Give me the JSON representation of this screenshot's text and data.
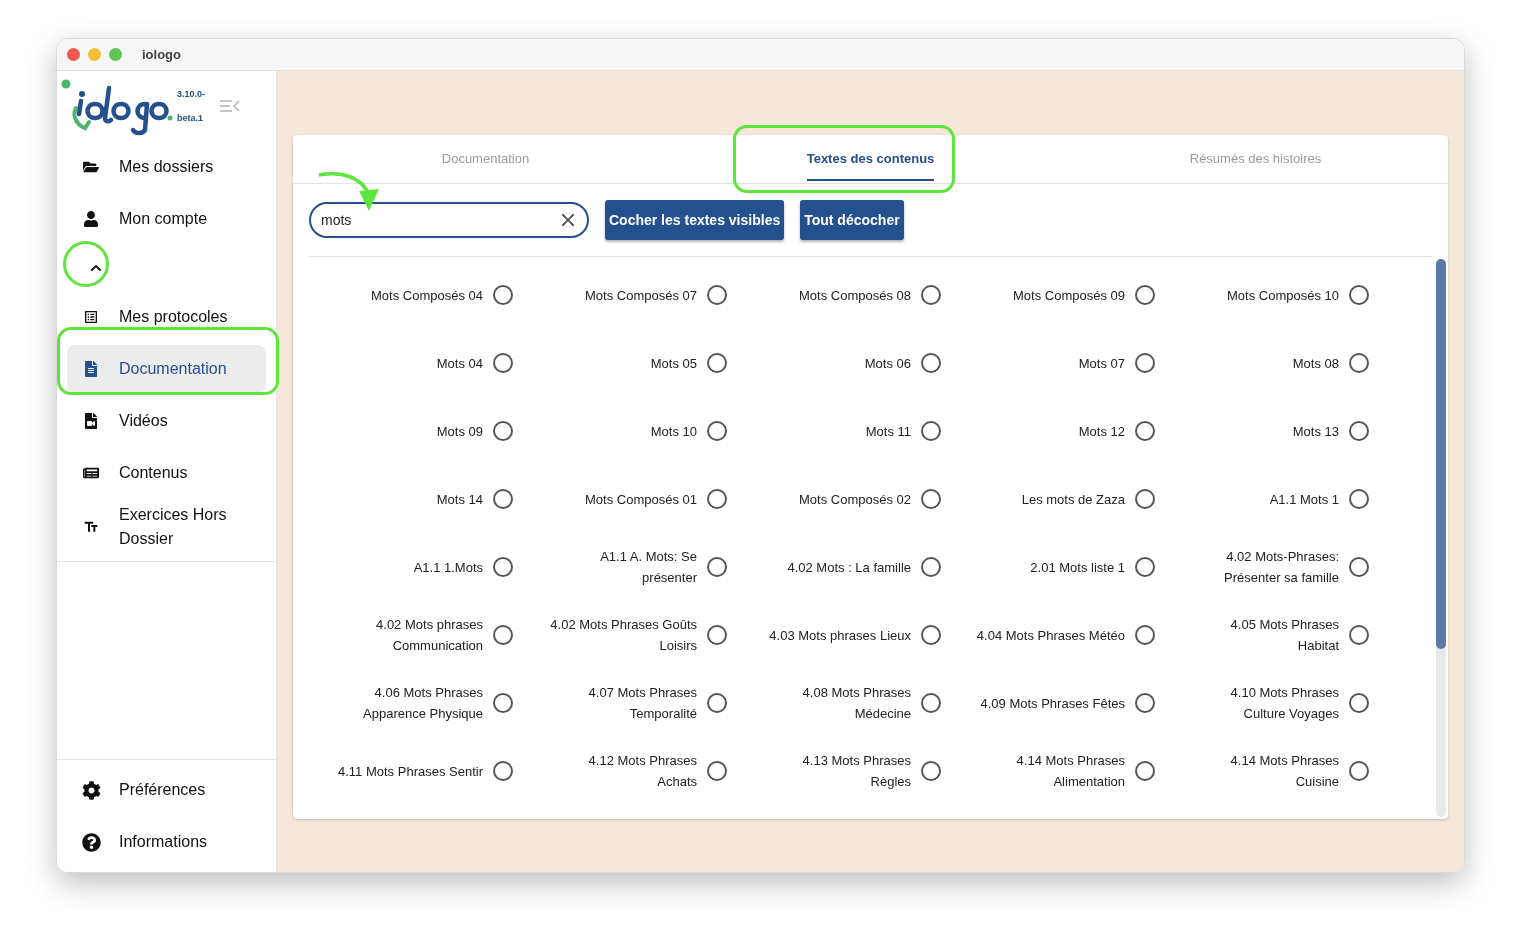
{
  "window": {
    "title": "iologo"
  },
  "logo": {
    "version_top": "3.10.0-",
    "version_bottom": "beta.1"
  },
  "sidebar": {
    "items": [
      {
        "label": "Mes dossiers",
        "selected": false
      },
      {
        "label": "Mon compte",
        "selected": false
      },
      {
        "kind": "collapse",
        "expanded": true
      },
      {
        "label": "Mes protocoles",
        "selected": false
      },
      {
        "label": "Documentation",
        "selected": true
      },
      {
        "label": "Vidéos",
        "selected": false
      },
      {
        "label": "Contenus",
        "selected": false
      },
      {
        "label": "Exercices Hors\nDossier",
        "selected": false
      }
    ],
    "bottom": [
      {
        "label": "Préférences"
      },
      {
        "label": "Informations"
      }
    ]
  },
  "tabs": [
    {
      "label": "Documentation",
      "selected": false
    },
    {
      "label": "Textes des contenus",
      "selected": true
    },
    {
      "label": "Résumés des histoires",
      "selected": false
    }
  ],
  "search": {
    "value": "mots"
  },
  "buttons": [
    "Cocher les textes visibles",
    "Tout décocher"
  ],
  "texts": [
    {
      "label": "Mots Composés 04",
      "checked": false
    },
    {
      "label": "Mots Composés 07",
      "checked": false
    },
    {
      "label": "Mots Composés 08",
      "checked": false
    },
    {
      "label": "Mots Composés 09",
      "checked": false
    },
    {
      "label": "Mots Composés 10",
      "checked": false
    },
    {
      "label": "Mots 04",
      "checked": false
    },
    {
      "label": "Mots 05",
      "checked": false
    },
    {
      "label": "Mots 06",
      "checked": false
    },
    {
      "label": "Mots 07",
      "checked": false
    },
    {
      "label": "Mots 08",
      "checked": false
    },
    {
      "label": "Mots 09",
      "checked": false
    },
    {
      "label": "Mots 10",
      "checked": false
    },
    {
      "label": "Mots 11",
      "checked": false
    },
    {
      "label": "Mots 12",
      "checked": false
    },
    {
      "label": "Mots 13",
      "checked": false
    },
    {
      "label": "Mots 14",
      "checked": false
    },
    {
      "label": "Mots Composés 01",
      "checked": false
    },
    {
      "label": "Mots Composés 02",
      "checked": false
    },
    {
      "label": "Les mots de Zaza",
      "checked": false
    },
    {
      "label": "A1.1 Mots 1",
      "checked": false
    },
    {
      "label": "A1.1 1.Mots",
      "checked": false
    },
    {
      "label": "A1.1 A. Mots: Se\nprésenter",
      "checked": false
    },
    {
      "label": "4.02 Mots : La famille",
      "checked": false
    },
    {
      "label": "2.01 Mots liste 1",
      "checked": false
    },
    {
      "label": "4.02 Mots-Phrases:\nPrésenter sa famille",
      "checked": false
    },
    {
      "label": "4.02 Mots phrases\nCommunication",
      "checked": false
    },
    {
      "label": "4.02 Mots Phrases Goûts\nLoisirs",
      "checked": false
    },
    {
      "label": "4.03 Mots phrases Lieux",
      "checked": false
    },
    {
      "label": "4.04 Mots Phrases Météo",
      "checked": false
    },
    {
      "label": "4.05 Mots Phrases\nHabitat",
      "checked": false
    },
    {
      "label": "4.06 Mots Phrases\nApparence Physique",
      "checked": false
    },
    {
      "label": "4.07 Mots Phrases\nTemporalité",
      "checked": false
    },
    {
      "label": "4.08 Mots Phrases\nMédecine",
      "checked": false
    },
    {
      "label": "4.09 Mots Phrases Fêtes",
      "checked": false
    },
    {
      "label": "4.10 Mots Phrases\nCulture Voyages",
      "checked": false
    },
    {
      "label": "4.11 Mots Phrases Sentir",
      "checked": false
    },
    {
      "label": "4.12 Mots Phrases\nAchats",
      "checked": false
    },
    {
      "label": "4.13 Mots Phrases\nRègles",
      "checked": false
    },
    {
      "label": "4.14 Mots Phrases\nAlimentation",
      "checked": false
    },
    {
      "label": "4.14 Mots Phrases\nCuisine",
      "checked": false
    }
  ]
}
